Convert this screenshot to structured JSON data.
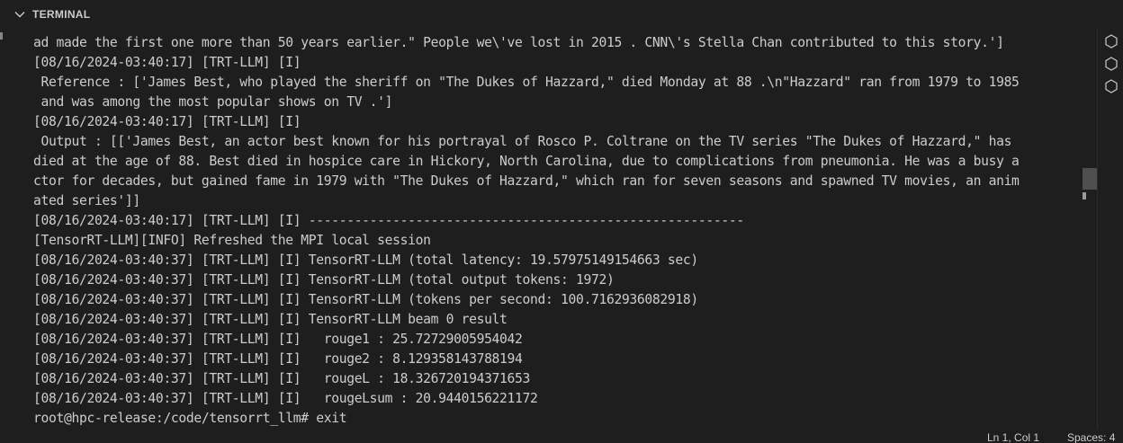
{
  "panel": {
    "title": "TERMINAL"
  },
  "terminal": {
    "lines": [
      "ad made the first one more than 50 years earlier.\" People we\\'ve lost in 2015 . CNN\\'s Stella Chan contributed to this story.']",
      "[08/16/2024-03:40:17] [TRT-LLM] [I]",
      " Reference : ['James Best, who played the sheriff on \"The Dukes of Hazzard,\" died Monday at 88 .\\n\"Hazzard\" ran from 1979 to 1985",
      " and was among the most popular shows on TV .']",
      "[08/16/2024-03:40:17] [TRT-LLM] [I]",
      " Output : [['James Best, an actor best known for his portrayal of Rosco P. Coltrane on the TV series \"The Dukes of Hazzard,\" has",
      "died at the age of 88. Best died in hospice care in Hickory, North Carolina, due to complications from pneumonia. He was a busy a",
      "ctor for decades, but gained fame in 1979 with \"The Dukes of Hazzard,\" which ran for seven seasons and spawned TV movies, an anim",
      "ated series']]",
      "[08/16/2024-03:40:17] [TRT-LLM] [I] ---------------------------------------------------------",
      "[TensorRT-LLM][INFO] Refreshed the MPI local session",
      "[08/16/2024-03:40:37] [TRT-LLM] [I] TensorRT-LLM (total latency: 19.57975149154663 sec)",
      "[08/16/2024-03:40:37] [TRT-LLM] [I] TensorRT-LLM (total output tokens: 1972)",
      "[08/16/2024-03:40:37] [TRT-LLM] [I] TensorRT-LLM (tokens per second: 100.7162936082918)",
      "[08/16/2024-03:40:37] [TRT-LLM] [I] TensorRT-LLM beam 0 result",
      "[08/16/2024-03:40:37] [TRT-LLM] [I]   rouge1 : 25.72729005954042",
      "[08/16/2024-03:40:37] [TRT-LLM] [I]   rouge2 : 8.129358143788194",
      "[08/16/2024-03:40:37] [TRT-LLM] [I]   rougeL : 18.326720194371653",
      "[08/16/2024-03:40:37] [TRT-LLM] [I]   rougeLsum : 20.9440156221172",
      "root@hpc-release:/code/tensorrt_llm# exit"
    ]
  },
  "status_bar": {
    "cursor_position": "Ln 1, Col 1",
    "spaces": "Spaces: 4"
  },
  "colors": {
    "background": "#1e1e1e",
    "text": "#cccccc",
    "scrollbar_thumb": "#4f4f4f"
  },
  "icons": {
    "collapse": "chevron-down-icon",
    "rail": [
      "hexagon-outline-icon",
      "hexagon-outline-icon",
      "hexagon-outline-icon"
    ]
  }
}
